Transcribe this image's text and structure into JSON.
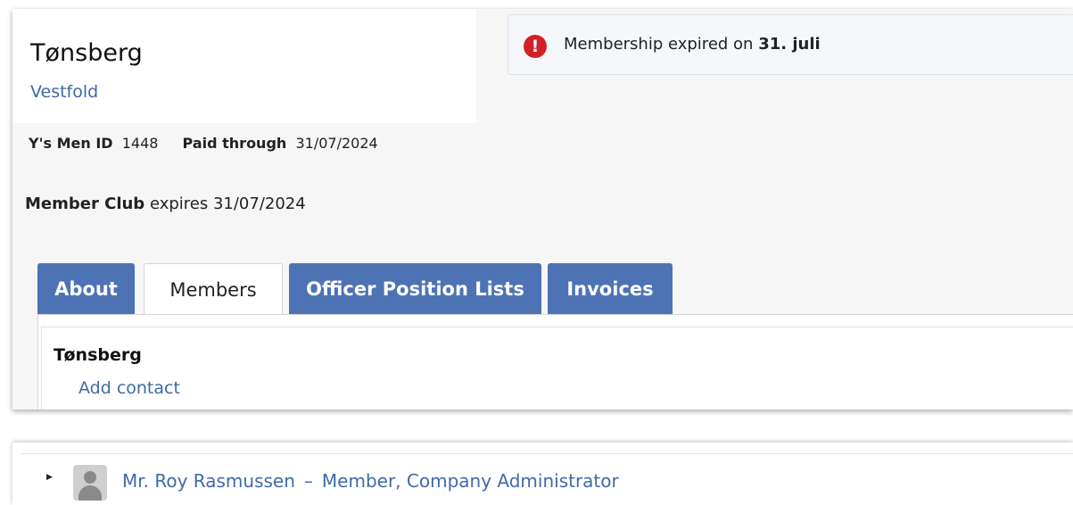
{
  "club": {
    "name": "Tønsberg",
    "region": "Vestfold"
  },
  "alert": {
    "text_prefix": "Membership expired on ",
    "date": "31. juli",
    "icon": "exclamation-circle-icon",
    "color": "#d12026"
  },
  "ids": {
    "ysmen_label": "Y's Men ID",
    "ysmen_value": "1448",
    "paid_label": "Paid through",
    "paid_value": "31/07/2024"
  },
  "membership": {
    "type": "Member Club",
    "expires_text": "expires 31/07/2024"
  },
  "tabs": [
    {
      "label": "About",
      "active": false
    },
    {
      "label": "Members",
      "active": true
    },
    {
      "label": "Officer Position Lists",
      "active": false
    },
    {
      "label": "Invoices",
      "active": false
    }
  ],
  "members_panel": {
    "title": "Tønsberg",
    "add_contact": "Add contact"
  },
  "member_rows": [
    {
      "name": "Mr. Roy Rasmussen",
      "separator": "–",
      "roles": "Member, Company Administrator",
      "avatar_icon": "user-placeholder-icon"
    }
  ],
  "colors": {
    "tab_inactive": "#4d73b4",
    "link": "#3f6aa8"
  }
}
